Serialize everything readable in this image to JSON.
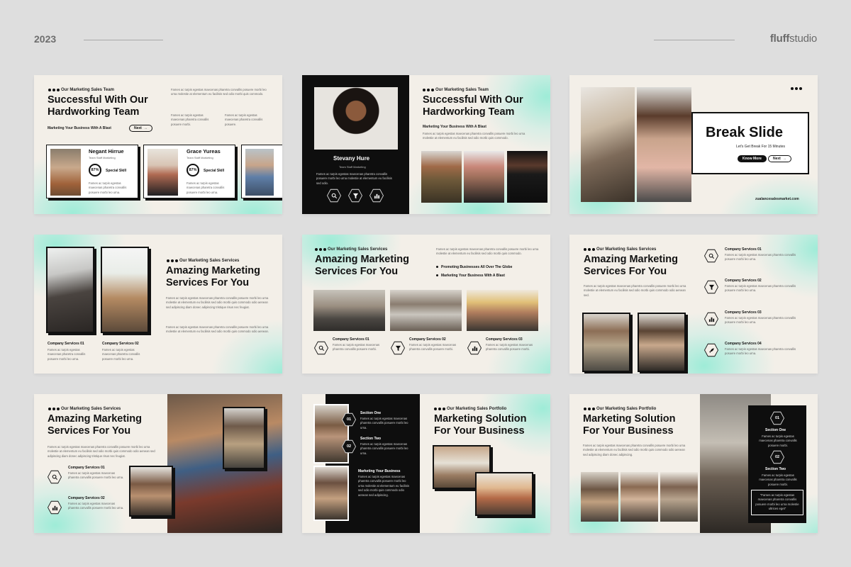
{
  "header": {
    "year": "2023",
    "brand_bold": "fluff",
    "brand_light": "studio"
  },
  "slides": {
    "s1": {
      "tag": "Our Marketing Sales Team",
      "title": "Successful With Our\nHardworking Team",
      "subtitle": "Marketing Your Business With A Blast",
      "next": "Next",
      "para": "Fames ac turpis egestas maecenas pharetra convallis posuere morbi leo urna molestie at elementum eu facilisis sed odio morbi quis commodo.",
      "para2": "Fames ac turpis egestas maecenas pharetra convallis posuere morbi.",
      "para3": "Fames ac turpis egestas maecenas pharetra convallis posuere.",
      "members": [
        {
          "name": "Negant Hirrue",
          "role": "Team Staff Marketing",
          "pct": "87%",
          "skill": "Special Skill",
          "bio": "Fames ac turpis egestas maecenas pharetra convallis posuere morbi leo urna."
        },
        {
          "name": "Grace Yureas",
          "role": "Team Staff Marketing",
          "pct": "87%",
          "skill": "Special Skill",
          "bio": "Fames ac turpis egestas maecenas pharetra convallis posuere morbi leo urna."
        }
      ]
    },
    "s2": {
      "tag": "Our Marketing Sales Team",
      "title": "Successful With Our\nHardworking Team",
      "subtitle": "Marketing Your Business With A Blast",
      "name": "Stevany Hure",
      "role": "Team Staff Marketing",
      "bio": "Fames ac turpis egestas maecenas pharetra convallis posuere morbi leo urna molestie at elementum eu facilisis sed odio.",
      "para": "Fames ac turpis egestas maecenas pharetra convallis posuere morbi leo urna molestie at elementum eu facilisis sed odio morbi quis commodo."
    },
    "s3": {
      "title": "Break Slide",
      "subtitle": "Let's Get Break For 15 Minutes",
      "btn1": "Know More",
      "btn2": "Next",
      "url": "zualancesalesmarket.com"
    },
    "s4": {
      "tag": "Our Marketing Sales Services",
      "title": "Amazing Marketing\nServices For You",
      "para": "Fames ac turpis egestas maecenas pharetra convallis posuere morbi leo urna molestie at elementum eu facilisis sed odio morbi quis commodo odio aenean sed adipiscing diam donec adipiscing tristique risus nec feugiat.",
      "para2": "Fames ac turpis egestas maecenas pharetra convallis posuere morbi leo urna molestie at elementum eu facilisis sed odio morbi quis commodo odio aenean.",
      "s1": "Company Services 01",
      "s2": "Company Services 02",
      "sdesc": "Fames ac turpis egestas maecenas pharetra convallis posuere morbi leo urna."
    },
    "s5": {
      "tag": "Our Marketing Sales Services",
      "title": "Amazing Marketing\nServices For You",
      "para": "Fames ac turpis egestas maecenas pharetra convallis posuere morbi leo urna molestie at elementum eu facilisis sed odio morbi quis commodo.",
      "b1": "Promoting Businesses All Over The Globe",
      "b2": "Marketing Your Business With A Blast",
      "svc": [
        "Company Services 01",
        "Company Services 02",
        "Company Services 03"
      ],
      "sdesc": "Fames ac turpis egestas maecenas pharetra convallis posuere morbi."
    },
    "s6": {
      "tag": "Our Marketing Sales Services",
      "title": "Amazing Marketing\nServices For You",
      "para": "Fames ac turpis egestas maecenas pharetra convallis posuere morbi leo urna molestie at elementum eu facilisis sed odio morbi quis commodo odio aenean sed.",
      "svc": [
        "Company Services 01",
        "Company Services 02",
        "Company Services 03",
        "Company Services 04"
      ],
      "sdesc": "Fames ac turpis egestas maecenas pharetra convallis posuere morbi leo urna."
    },
    "s7": {
      "tag": "Our Marketing Sales Services",
      "title": "Amazing Marketing\nServices For You",
      "para": "Fames ac turpis egestas maecenas pharetra convallis posuere morbi leo urna molestie at elementum eu facilisis sed odio morbi quis commodo odio aenean sed adipiscing diam donec adipiscing tristique risus nec feugiat.",
      "svc": [
        "Company Services 01",
        "Company Services 02"
      ],
      "sdesc": "Fames ac turpis egestas maecenas pharetra convallis posuere morbi leo urna."
    },
    "s8": {
      "tag": "Our Marketing Sales Portfolio",
      "title": "Marketing Solution\nFor Your Business",
      "sec1": "Section One",
      "sec2": "Section Two",
      "sec3": "Marketing Your Business",
      "n1": "01",
      "n2": "02",
      "sdesc": "Fames ac turpis egestas maecenas pharetra convallis posuere morbi leo urna.",
      "para": "Fames ac turpis egestas maecenas pharetra convallis posuere morbi leo urna molestie at elementum eu facilisis sed odio morbi quis commodo odio aenean sed adipiscing."
    },
    "s9": {
      "tag": "Our Marketing Sales Portfolio",
      "title": "Marketing Solution\nFor Your Business",
      "para": "Fames ac turpis egestas maecenas pharetra convallis posuere morbi leo urna molestie at elementum eu facilisis sed odio morbi quis commodo odio aenean sed adipiscing diam donec adipiscing.",
      "sec1": "Section One",
      "sec2": "Section Two",
      "n1": "01",
      "n2": "02",
      "sdesc": "Fames ac turpis egestas maecenas pharetra convallis posuere morbi.",
      "quote": "\"Fames ac turpis egestas maecenas pharetra convallis posuere morbi leo urna molestie ultrices eget\""
    }
  }
}
